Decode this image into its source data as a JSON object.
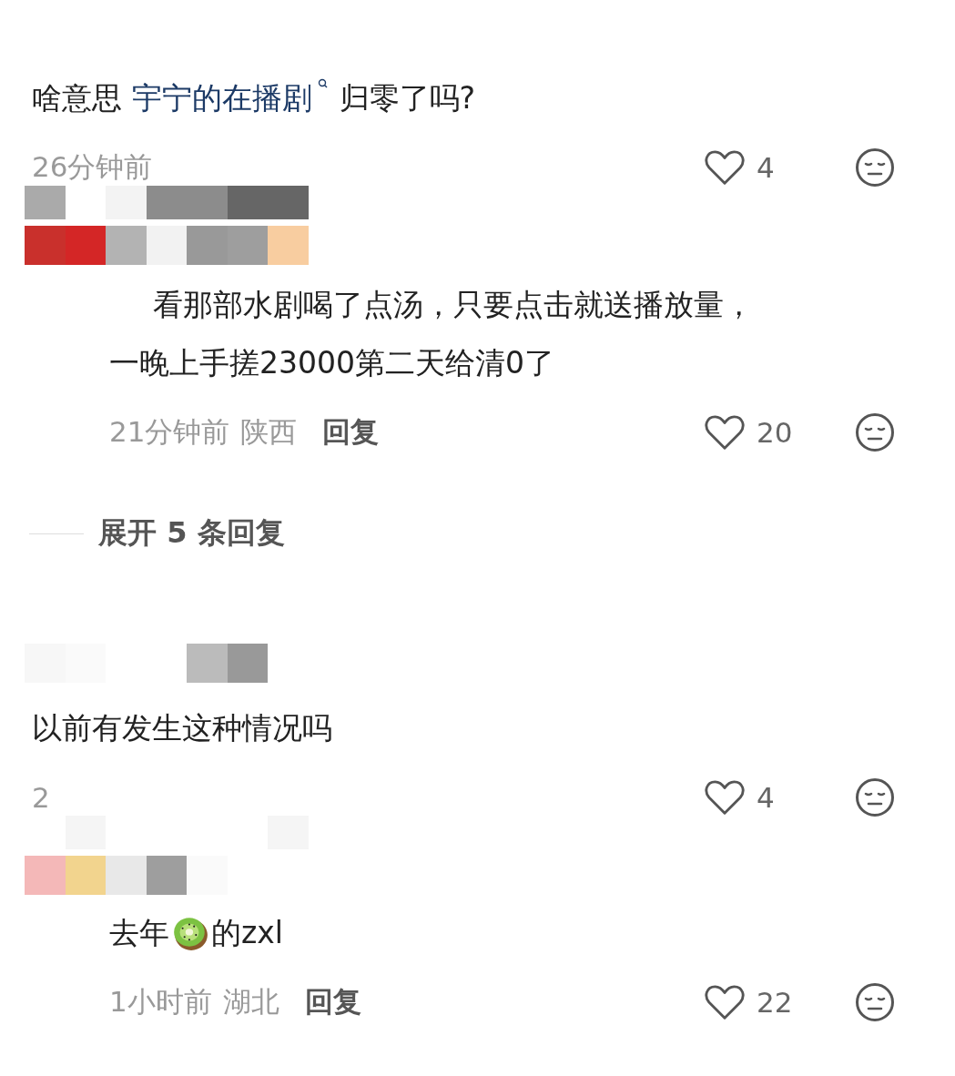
{
  "comments": [
    {
      "kind": "comment",
      "body": [
        {
          "kind": "text",
          "text": "啥意思 "
        },
        {
          "kind": "link",
          "text": "宇宁的在播剧"
        },
        {
          "kind": "text",
          "text": "归零了吗?"
        }
      ],
      "time": "26分钟前",
      "likes": "4"
    },
    {
      "kind": "reply",
      "lines": [
        "看那部水剧喝了点汤，只要点击就送播放量，",
        "一晚上手搓23000第二天给清0了"
      ],
      "time": "21分钟前",
      "location": "陕西",
      "reply": "回复",
      "likes": "20"
    },
    {
      "kind": "expand",
      "text": "展开 5 条回复"
    },
    {
      "kind": "comment",
      "body": [
        {
          "kind": "text",
          "text": "以前有发生这种情况吗"
        }
      ],
      "time": "2",
      "likes": "4"
    },
    {
      "kind": "reply",
      "body": [
        {
          "kind": "text",
          "text": "去年"
        },
        {
          "kind": "kiwi"
        },
        {
          "kind": "text",
          "text": "的zxl"
        }
      ],
      "time": "1小时前",
      "location": "湖北",
      "reply": "回复",
      "likes": "22"
    }
  ]
}
